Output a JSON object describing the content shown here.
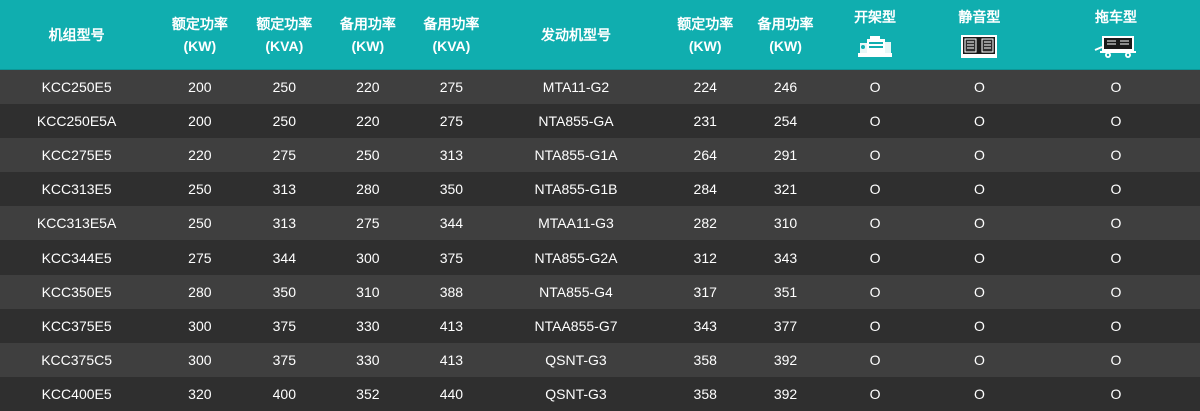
{
  "headers": [
    {
      "line1": "机组型号",
      "line2": ""
    },
    {
      "line1": "额定功率",
      "line2": "(KW)"
    },
    {
      "line1": "额定功率",
      "line2": "(KVA)"
    },
    {
      "line1": "备用功率",
      "line2": "(KW)"
    },
    {
      "line1": "备用功率",
      "line2": "(KVA)"
    },
    {
      "line1": "发动机型号",
      "line2": ""
    },
    {
      "line1": "额定功率",
      "line2": "(KW)"
    },
    {
      "line1": "备用功率",
      "line2": "(KW)"
    },
    {
      "line1": "开架型",
      "icon": "open-frame-generator-icon"
    },
    {
      "line1": "静音型",
      "icon": "silent-generator-icon"
    },
    {
      "line1": "拖车型",
      "icon": "trailer-generator-icon"
    }
  ],
  "rows": [
    [
      "KCC250E5",
      "200",
      "250",
      "220",
      "275",
      "MTA11-G2",
      "224",
      "246",
      "O",
      "O",
      "O"
    ],
    [
      "KCC250E5A",
      "200",
      "250",
      "220",
      "275",
      "NTA855-GA",
      "231",
      "254",
      "O",
      "O",
      "O"
    ],
    [
      "KCC275E5",
      "220",
      "275",
      "250",
      "313",
      "NTA855-G1A",
      "264",
      "291",
      "O",
      "O",
      "O"
    ],
    [
      "KCC313E5",
      "250",
      "313",
      "280",
      "350",
      "NTA855-G1B",
      "284",
      "321",
      "O",
      "O",
      "O"
    ],
    [
      "KCC313E5A",
      "250",
      "313",
      "275",
      "344",
      "MTAA11-G3",
      "282",
      "310",
      "O",
      "O",
      "O"
    ],
    [
      "KCC344E5",
      "275",
      "344",
      "300",
      "375",
      "NTA855-G2A",
      "312",
      "343",
      "O",
      "O",
      "O"
    ],
    [
      "KCC350E5",
      "280",
      "350",
      "310",
      "388",
      "NTA855-G4",
      "317",
      "351",
      "O",
      "O",
      "O"
    ],
    [
      "KCC375E5",
      "300",
      "375",
      "330",
      "413",
      "NTAA855-G7",
      "343",
      "377",
      "O",
      "O",
      "O"
    ],
    [
      "KCC375C5",
      "300",
      "375",
      "330",
      "413",
      "QSNT-G3",
      "358",
      "392",
      "O",
      "O",
      "O"
    ],
    [
      "KCC400E5",
      "320",
      "400",
      "352",
      "440",
      "QSNT-G3",
      "358",
      "392",
      "O",
      "O",
      "O"
    ]
  ],
  "colors": {
    "header_bg": "#10aeaf",
    "row_odd": "#3f3f3f",
    "row_even": "#2f2f2f",
    "text": "#ffffff"
  }
}
